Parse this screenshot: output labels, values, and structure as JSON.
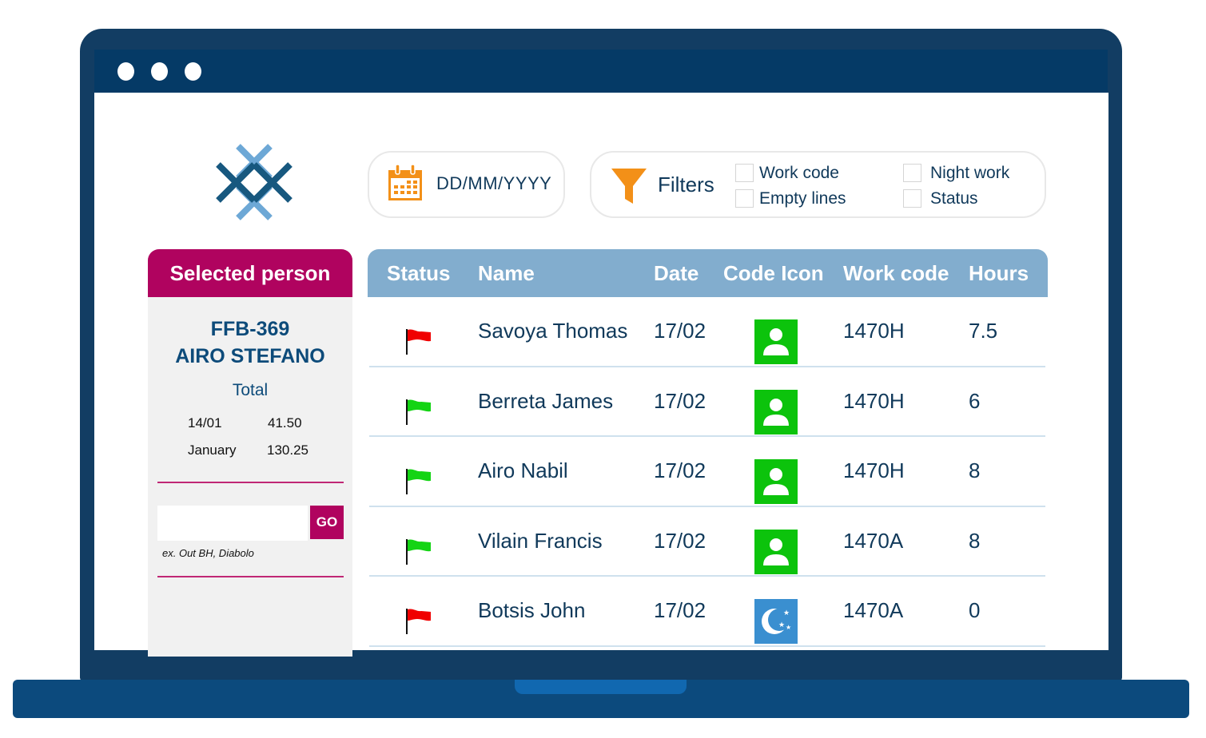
{
  "window": {
    "controls": [
      "close-dot",
      "minimize-dot",
      "maximize-dot"
    ]
  },
  "logo": {
    "icon": "crossed-lines-logo",
    "colors": {
      "dark": "#17587f",
      "light": "#6da8d6"
    }
  },
  "date_picker": {
    "icon": "calendar-icon",
    "placeholder": "DD/MM/YYYY",
    "icon_color": "#f39018"
  },
  "filters": {
    "icon": "funnel-icon",
    "label": "Filters",
    "options": [
      {
        "label": "Work code",
        "checked": false
      },
      {
        "label": "Empty lines",
        "checked": false
      },
      {
        "label": "Night work",
        "checked": false
      },
      {
        "label": "Status",
        "checked": false
      }
    ]
  },
  "selected_person": {
    "title": "Selected person",
    "id": "FFB-369",
    "name": "AIRO STEFANO",
    "total_label": "Total",
    "totals": [
      {
        "label": "14/01",
        "value": "41.50"
      },
      {
        "label": "January",
        "value": "130.25"
      }
    ],
    "search": {
      "value": "",
      "button_label": "GO",
      "hint": "ex. Out BH, Diabolo"
    }
  },
  "table": {
    "columns": [
      "Status",
      "Name",
      "Date",
      "Code Icon",
      "Work code",
      "Hours"
    ],
    "rows": [
      {
        "status": "red",
        "name": "Savoya Thomas",
        "date": "17/02",
        "code_icon": "person-icon",
        "work_code": "1470H",
        "hours": "7.5"
      },
      {
        "status": "green",
        "name": "Berreta James",
        "date": "17/02",
        "code_icon": "person-icon",
        "work_code": "1470H",
        "hours": "6"
      },
      {
        "status": "green",
        "name": "Airo Nabil",
        "date": "17/02",
        "code_icon": "person-icon",
        "work_code": "1470H",
        "hours": "8"
      },
      {
        "status": "green",
        "name": "Vilain Francis",
        "date": "17/02",
        "code_icon": "person-icon",
        "work_code": "1470A",
        "hours": "8"
      },
      {
        "status": "red",
        "name": "Botsis John",
        "date": "17/02",
        "code_icon": "night-moon-icon",
        "work_code": "1470A",
        "hours": "0"
      }
    ]
  },
  "colors": {
    "frame": "#123d63",
    "accent": "#b0035f",
    "header": "#82adce",
    "text": "#10395a",
    "status_red": "#f00000",
    "status_green": "#14d414",
    "code_person_bg": "#0cc30c",
    "code_night_bg": "#3a8fd0"
  }
}
